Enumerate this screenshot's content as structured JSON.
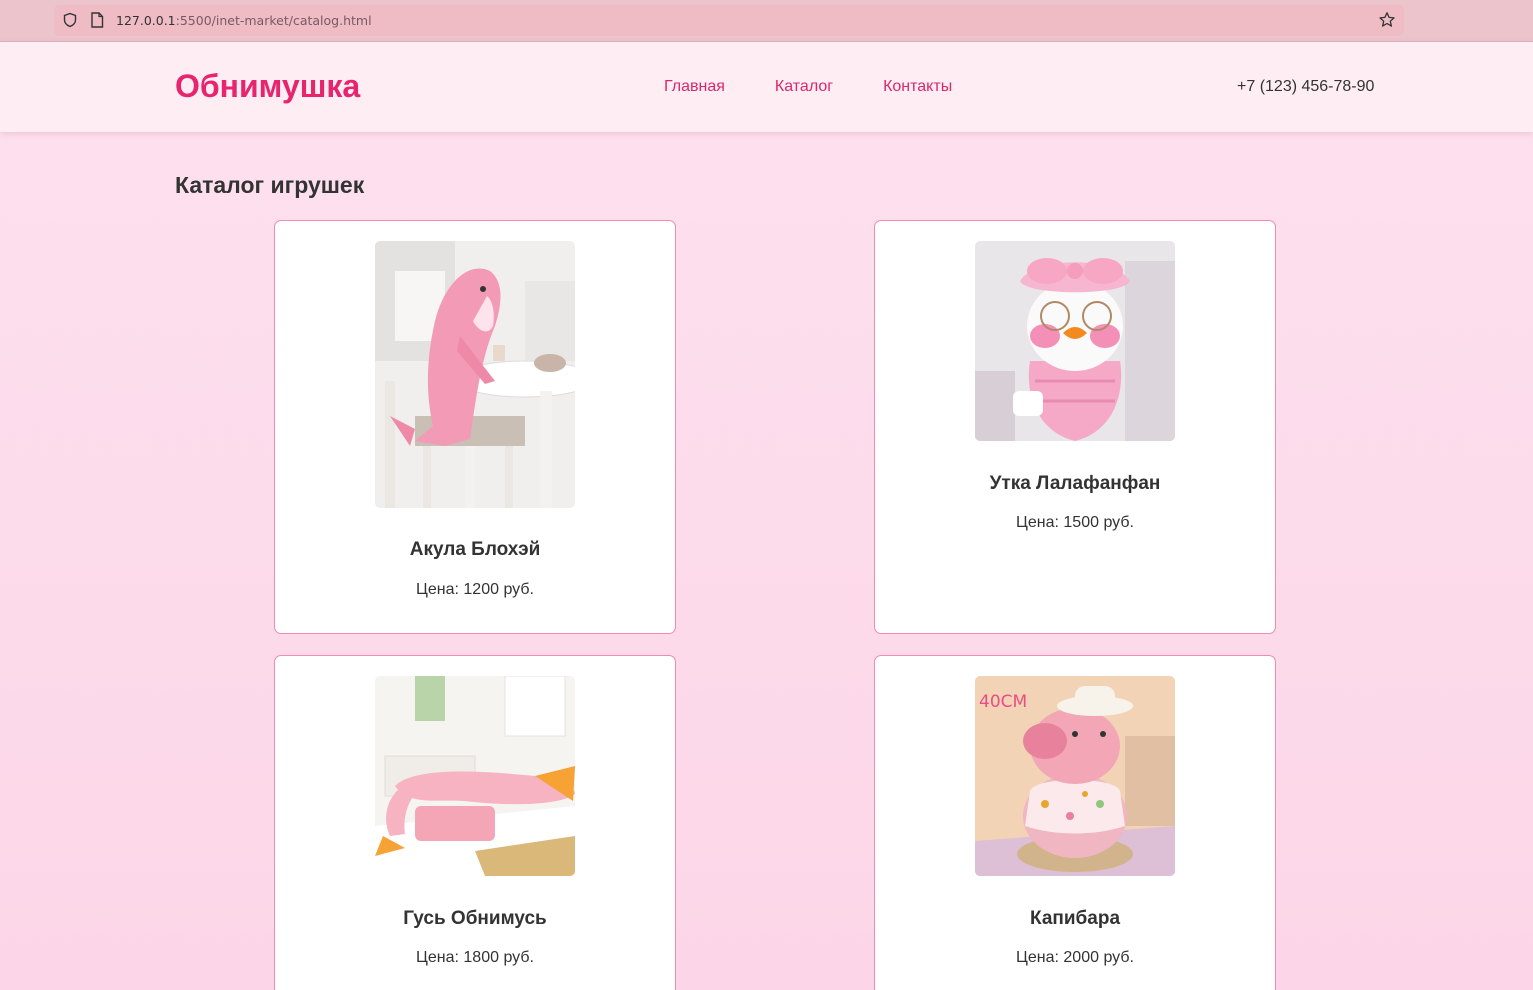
{
  "browser": {
    "url_host": "127.0.0.1",
    "url_rest": ":5500/inet-market/catalog.html"
  },
  "header": {
    "logo": "Обнимушка",
    "nav": [
      "Главная",
      "Каталог",
      "Контакты"
    ],
    "phone": "+7 (123) 456-78-90"
  },
  "catalog": {
    "title": "Каталог игрушек",
    "products": [
      {
        "name": "Акула Блохэй",
        "price": "Цена: 1200 руб."
      },
      {
        "name": "Утка Лалафанфан",
        "price": "Цена: 1500 руб."
      },
      {
        "name": "Гусь Обнимусь",
        "price": "Цена: 1800 руб."
      },
      {
        "name": "Капибара",
        "price": "Цена: 2000 руб."
      }
    ],
    "capybara_image_label": "40CM"
  },
  "colors": {
    "accent": "#e8246f",
    "background": "#fde1ee",
    "card_border": "#f08bb1"
  }
}
